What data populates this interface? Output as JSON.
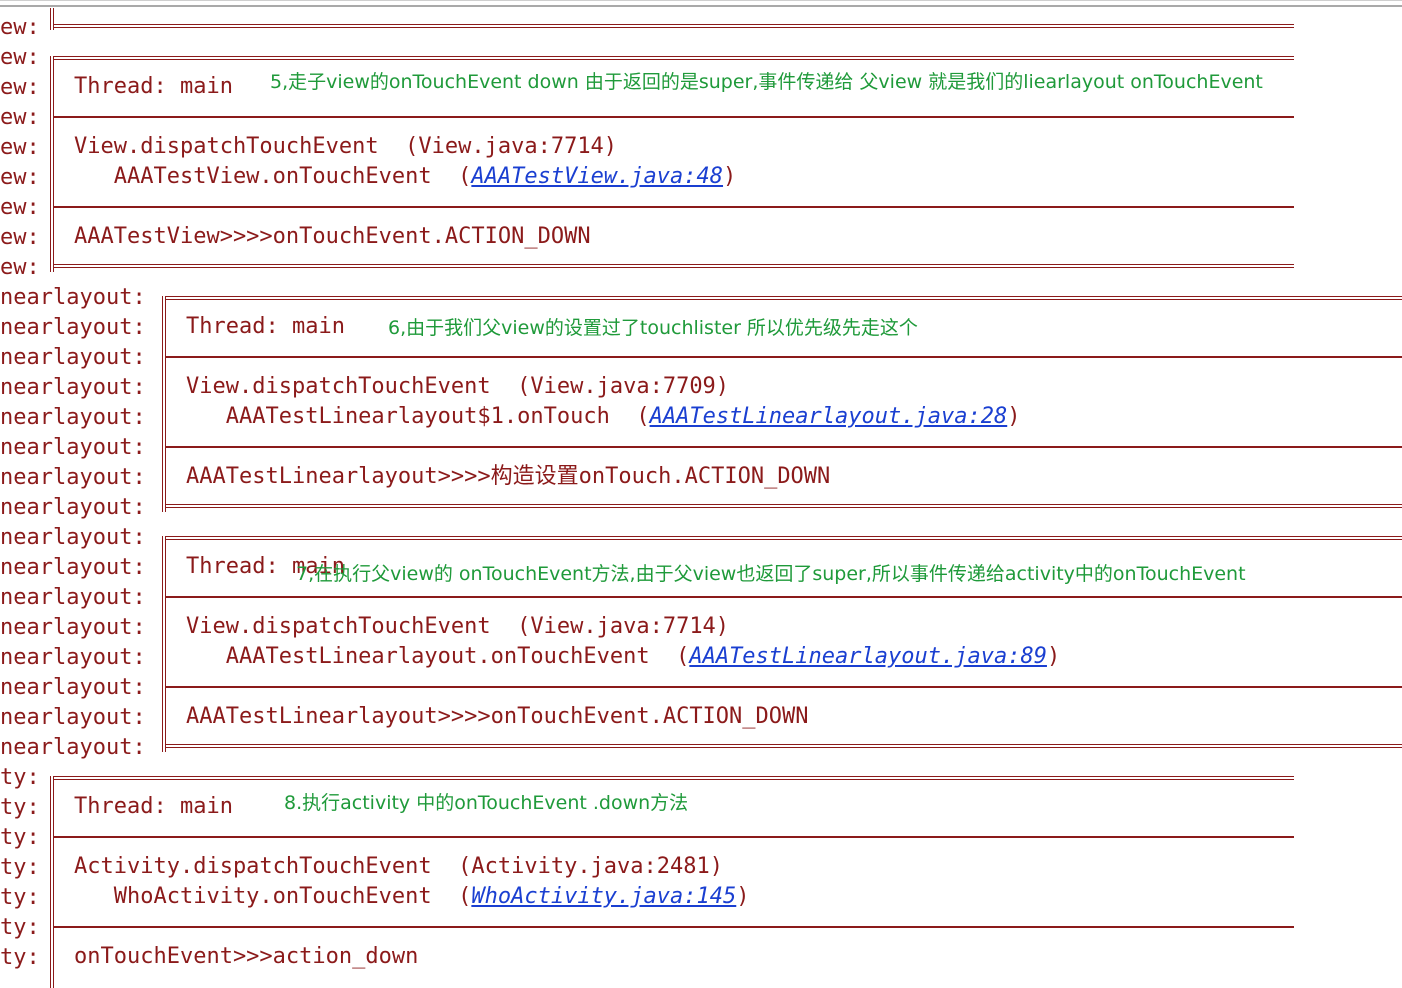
{
  "gutter": {
    "lines": [
      "ew:",
      "ew:",
      "ew:",
      "ew:",
      "ew:",
      "ew:",
      "ew:",
      "ew:",
      "ew:",
      "nearlayout:",
      "nearlayout:",
      "nearlayout:",
      "nearlayout:",
      "nearlayout:",
      "nearlayout:",
      "nearlayout:",
      "nearlayout:",
      "nearlayout:",
      "nearlayout:",
      "nearlayout:",
      "nearlayout:",
      "nearlayout:",
      "nearlayout:",
      "nearlayout:",
      "nearlayout:",
      "ty:",
      "ty:",
      "ty:",
      "ty:",
      "ty:",
      "ty:",
      "ty:"
    ]
  },
  "frames": [
    {
      "thread": "Thread: main",
      "note": "5,走子view的onTouchEvent down 由于返回的是super,事件传递给 父view 就是我们的liearlayout onTouchEvent",
      "line1": "View.dispatchTouchEvent  (View.java:7714)",
      "line2_prefix": "   AAATestView.onTouchEvent  (",
      "line2_link": "AAATestView.java:48",
      "line2_suffix": ")",
      "message": "AAATestView>>>>onTouchEvent.ACTION_DOWN"
    },
    {
      "thread": "Thread: main",
      "note": "6,由于我们父view的设置过了touchlister 所以优先级先走这个",
      "line1": "View.dispatchTouchEvent  (View.java:7709)",
      "line2_prefix": "   AAATestLinearlayout$1.onTouch  (",
      "line2_link": "AAATestLinearlayout.java:28",
      "line2_suffix": ")",
      "message": "AAATestLinearlayout>>>>构造设置onTouch.ACTION_DOWN"
    },
    {
      "thread": "Thread: main",
      "note": "7,在执行父view的 onTouchEvent方法,由于父view也返回了super,所以事件传递给activity中的onTouchEvent",
      "line1": "View.dispatchTouchEvent  (View.java:7714)",
      "line2_prefix": "   AAATestLinearlayout.onTouchEvent  (",
      "line2_link": "AAATestLinearlayout.java:89",
      "line2_suffix": ")",
      "message": "AAATestLinearlayout>>>>onTouchEvent.ACTION_DOWN"
    },
    {
      "thread": "Thread: main",
      "note": "8.执行activity 中的onTouchEvent .down方法",
      "line1": "Activity.dispatchTouchEvent  (Activity.java:2481)",
      "line2_prefix": "   WhoActivity.onTouchEvent  (",
      "line2_link": "WhoActivity.java:145",
      "line2_suffix": ")",
      "message": "onTouchEvent>>>action_down"
    }
  ]
}
